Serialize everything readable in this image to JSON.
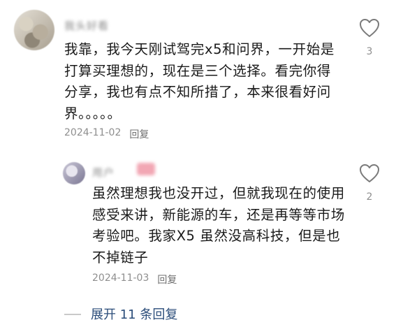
{
  "comment": {
    "username": "我头好看",
    "text": "我靠，我今天刚试驾完x5和问界，一开始是打算买理想的，现在是三个选择。看完你得分享，我也有点不知所措了，本来很看好问界。。。。。",
    "date": "2024-11-02",
    "reply_label": "回复",
    "likes": "3"
  },
  "reply": {
    "username": "用户",
    "text": "虽然理想我也没开过，但就我现在的使用感受来讲，新能源的车，还是再等等市场考验吧。我家X5 虽然没高科技，但是也不掉链子",
    "date": "2024-11-03",
    "reply_label": "回复",
    "likes": "2"
  },
  "expand": {
    "label": "展开 11 条回复"
  },
  "colors": {
    "link": "#2b4d7a",
    "meta": "#8e8e8e"
  },
  "icons": {
    "like": "heart-outline-icon"
  }
}
